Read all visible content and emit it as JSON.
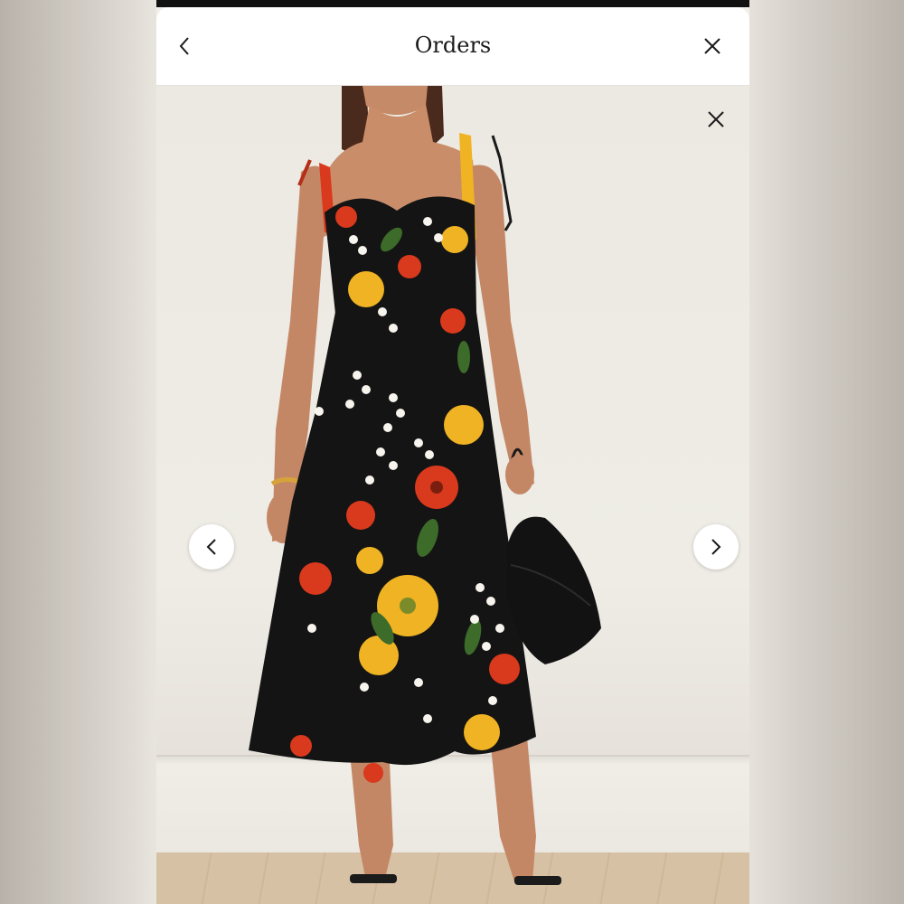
{
  "header": {
    "title": "Orders",
    "back_icon": "chevron-left-icon",
    "close_icon": "close-icon"
  },
  "viewer": {
    "close_icon": "close-icon",
    "prev_icon": "chevron-left-icon",
    "next_icon": "chevron-right-icon"
  },
  "colors": {
    "header_bg": "#ffffff",
    "text": "#1a1a1a",
    "dress_base": "#141414",
    "flower_red": "#d9391c",
    "flower_yellow": "#f0b323",
    "flower_white": "#f7f4ee",
    "leaf_green": "#3c6b2a"
  }
}
